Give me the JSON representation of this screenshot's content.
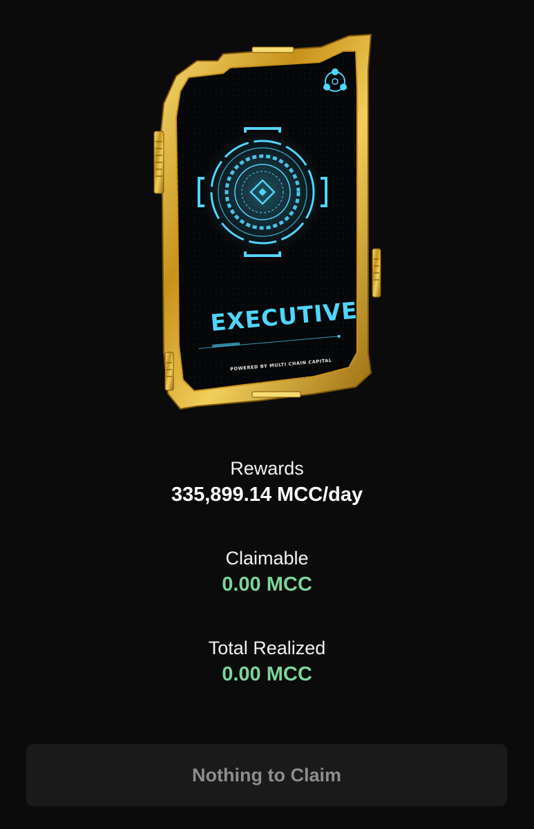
{
  "card": {
    "title": "EXECUTIVE",
    "footer": "POWERED BY MULTI CHAIN CAPITAL",
    "logo_icon": "mcc-logo-icon",
    "emblem_icon": "hud-target-icon",
    "colors": {
      "frame": "#d4a21e",
      "frame_light": "#f5d56a",
      "accent": "#4fd6ff",
      "card_bg": "#050607"
    }
  },
  "stats": {
    "rewards": {
      "label": "Rewards",
      "value": "335,899.14 MCC/day"
    },
    "claimable": {
      "label": "Claimable",
      "value": "0.00 MCC"
    },
    "total_realized": {
      "label": "Total Realized",
      "value": "0.00 MCC"
    }
  },
  "claim_button": {
    "label": "Nothing to Claim",
    "disabled": true
  },
  "colors": {
    "background": "#0b0b0b",
    "positive_value": "#7cd49a",
    "button_bg": "#1a1a1a",
    "button_text": "#8d8d8d"
  }
}
